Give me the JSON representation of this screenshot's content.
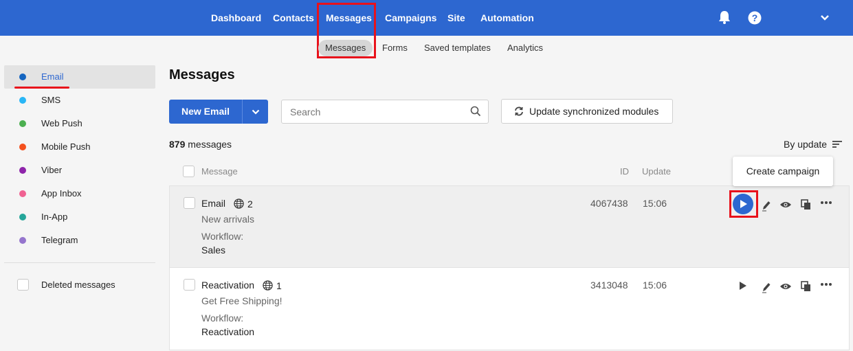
{
  "top_nav": {
    "items": [
      "Dashboard",
      "Contacts",
      "Messages",
      "Campaigns",
      "Site",
      "Automation"
    ],
    "active": "Messages"
  },
  "top_icons": [
    "bell-icon",
    "help-icon",
    "chevron-down-icon"
  ],
  "sub_nav": {
    "items": [
      "Messages",
      "Forms",
      "Saved templates",
      "Analytics"
    ],
    "active": "Messages"
  },
  "sidebar": {
    "items": [
      {
        "label": "Email",
        "color": "#1565c0"
      },
      {
        "label": "SMS",
        "color": "#29b6f6"
      },
      {
        "label": "Web Push",
        "color": "#4caf50"
      },
      {
        "label": "Mobile Push",
        "color": "#f4511e"
      },
      {
        "label": "Viber",
        "color": "#8e24aa"
      },
      {
        "label": "App Inbox",
        "color": "#f06292"
      },
      {
        "label": "In-App",
        "color": "#26a69a"
      },
      {
        "label": "Telegram",
        "color": "#9575cd"
      }
    ],
    "deleted_label": "Deleted messages"
  },
  "main": {
    "title": "Messages",
    "new_button_label": "New Email",
    "search_placeholder": "Search",
    "sync_button_label": "Update synchronized modules",
    "count_number": "879",
    "count_suffix": "messages",
    "sort_label": "By update",
    "columns": {
      "message": "Message",
      "id": "ID",
      "update": "Update"
    },
    "tooltip": "Create campaign",
    "rows": [
      {
        "name": "Email",
        "languages": "2",
        "subject": "New arrivals",
        "workflow_label": "Workflow:",
        "workflow": "Sales",
        "id": "4067438",
        "update": "15:06"
      },
      {
        "name": "Reactivation",
        "languages": "1",
        "subject": "Get Free Shipping!",
        "workflow_label": "Workflow:",
        "workflow": "Reactivation",
        "id": "3413048",
        "update": "15:06"
      }
    ]
  },
  "colors": {
    "brand": "#2d67d0",
    "highlight": "#e8121b"
  }
}
